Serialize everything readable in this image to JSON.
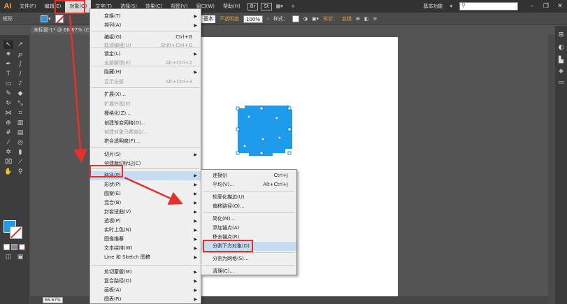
{
  "app": {
    "logo": "Ai"
  },
  "menubar": {
    "items": [
      "文件(F)",
      "编辑(E)",
      "对象(O)",
      "文字(T)",
      "选择(S)",
      "效果(C)",
      "视图(V)",
      "窗口(W)",
      "帮助(H)"
    ],
    "workspace": "基本功能"
  },
  "controlbar": {
    "tool_name": "矩形",
    "fill_color": "#1e9bea",
    "stroke_style": "基本",
    "opacity_label": "不透明度",
    "opacity_value": "100%",
    "style_label": "样式：",
    "shape_label": "形状：",
    "transform_label": "变换"
  },
  "document": {
    "tab": "未标题-1* @ 66.67% (C",
    "zoom": "66.67%"
  },
  "object_menu": {
    "items": [
      {
        "label": "变换(T)",
        "shortcut": "",
        "submenu": true,
        "disabled": false
      },
      {
        "label": "排列(A)",
        "shortcut": "",
        "submenu": true,
        "disabled": false
      },
      {
        "label": "编组(G)",
        "shortcut": "Ctrl+G",
        "submenu": false,
        "disabled": false
      },
      {
        "label": "取消编组(U)",
        "shortcut": "Shift+Ctrl+G",
        "submenu": false,
        "disabled": true
      },
      {
        "label": "锁定(L)",
        "shortcut": "",
        "submenu": true,
        "disabled": false
      },
      {
        "label": "全部解锁(K)",
        "shortcut": "Alt+Ctrl+2",
        "submenu": false,
        "disabled": true
      },
      {
        "label": "隐藏(H)",
        "shortcut": "",
        "submenu": true,
        "disabled": false
      },
      {
        "label": "显示全部",
        "shortcut": "Alt+Ctrl+3",
        "submenu": false,
        "disabled": true
      },
      {
        "label": "扩展(X)...",
        "shortcut": "",
        "submenu": false,
        "disabled": false
      },
      {
        "label": "扩展外观(E)",
        "shortcut": "",
        "submenu": false,
        "disabled": true
      },
      {
        "label": "栅格化(Z)...",
        "shortcut": "",
        "submenu": false,
        "disabled": false
      },
      {
        "label": "创建渐变网格(D)...",
        "shortcut": "",
        "submenu": false,
        "disabled": false
      },
      {
        "label": "创建对象马赛克(J)...",
        "shortcut": "",
        "submenu": false,
        "disabled": true
      },
      {
        "label": "拼合透明度(F)...",
        "shortcut": "",
        "submenu": false,
        "disabled": false
      },
      {
        "label": "切片(S)",
        "shortcut": "",
        "submenu": true,
        "disabled": false
      },
      {
        "label": "创建裁切标记(C)",
        "shortcut": "",
        "submenu": false,
        "disabled": false
      },
      {
        "label": "路径(P)",
        "shortcut": "",
        "submenu": true,
        "disabled": false
      },
      {
        "label": "形状(P)",
        "shortcut": "",
        "submenu": true,
        "disabled": false
      },
      {
        "label": "图案(E)",
        "shortcut": "",
        "submenu": true,
        "disabled": false
      },
      {
        "label": "混合(B)",
        "shortcut": "",
        "submenu": true,
        "disabled": false
      },
      {
        "label": "封套扭曲(V)",
        "shortcut": "",
        "submenu": true,
        "disabled": false
      },
      {
        "label": "透视(P)",
        "shortcut": "",
        "submenu": true,
        "disabled": false
      },
      {
        "label": "实时上色(N)",
        "shortcut": "",
        "submenu": true,
        "disabled": false
      },
      {
        "label": "图像描摹",
        "shortcut": "",
        "submenu": true,
        "disabled": false
      },
      {
        "label": "文本绕排(W)",
        "shortcut": "",
        "submenu": true,
        "disabled": false
      },
      {
        "label": "Line 和 Sketch 图稿",
        "shortcut": "",
        "submenu": true,
        "disabled": false
      },
      {
        "label": "剪切蒙版(M)",
        "shortcut": "",
        "submenu": true,
        "disabled": false
      },
      {
        "label": "复合路径(O)",
        "shortcut": "",
        "submenu": true,
        "disabled": false
      },
      {
        "label": "画板(A)",
        "shortcut": "",
        "submenu": true,
        "disabled": false
      },
      {
        "label": "图表(R)",
        "shortcut": "",
        "submenu": true,
        "disabled": false
      }
    ]
  },
  "path_submenu": {
    "items": [
      {
        "label": "连接(J)",
        "shortcut": "Ctrl+J"
      },
      {
        "label": "平均(V)...",
        "shortcut": "Alt+Ctrl+J"
      },
      {
        "label": "轮廓化描边(U)",
        "shortcut": ""
      },
      {
        "label": "偏移路径(O)...",
        "shortcut": ""
      },
      {
        "label": "简化(M)...",
        "shortcut": ""
      },
      {
        "label": "添加锚点(A)",
        "shortcut": ""
      },
      {
        "label": "移去锚点(R)",
        "shortcut": ""
      },
      {
        "label": "分割下方对象(D)",
        "shortcut": ""
      },
      {
        "label": "分割为网格(S)...",
        "shortcut": ""
      },
      {
        "label": "清理(C)...",
        "shortcut": ""
      }
    ]
  },
  "colors": {
    "accent": "#1e9bea",
    "annotation": "#e8302b",
    "highlight": "#c5dcf3"
  }
}
